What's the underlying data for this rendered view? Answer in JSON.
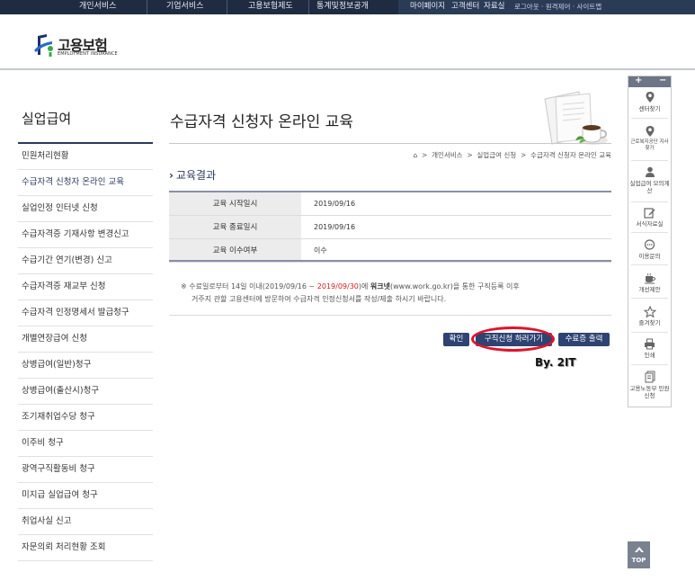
{
  "topnav": {
    "menu": [
      "개인서비스",
      "기업서비스",
      "고용보험제도",
      "통계및정보공개"
    ],
    "quick": [
      "마이페이지",
      "고객센터",
      "자료실"
    ],
    "util": "로그아웃 · 원격제어 · 사이트맵"
  },
  "logo": {
    "title": "고용보험",
    "subtitle": "EMPLOYMENT INSURANCE"
  },
  "sidebar": {
    "title": "실업급여",
    "items": [
      "민원처리현황",
      "수급자격 신청자 온라인 교육",
      "실업인정 인터넷 신청",
      "수급자격증 기재사항 변경신고",
      "수급기간 연기(변경) 신고",
      "수급자격증 재교부 신청",
      "수급자격 인정명세서 발급청구",
      "개별연장급여 신청",
      "상병급여(일반)청구",
      "상병급여(출산시)청구",
      "조기재취업수당 청구",
      "이주비 청구",
      "광역구직활동비 청구",
      "미지급 실업급여 청구",
      "취업사실 신고",
      "자문의뢰 처리현황 조회"
    ]
  },
  "main": {
    "title": "수급자격 신청자 온라인 교육",
    "breadcrumb": [
      "개인서비스",
      "실업급여 신청",
      "수급자격 신청자 온라인 교육"
    ],
    "section_title": "교육결과"
  },
  "result": {
    "rows": [
      {
        "label": "교육 시작일시",
        "value": "2019/09/16"
      },
      {
        "label": "교육 종료일시",
        "value": "2019/09/16"
      },
      {
        "label": "교육 이수여부",
        "value": "이수"
      }
    ]
  },
  "notice": {
    "l1_a": "※ 수료일로부터 14일 이내(2019/09/16 ~ ",
    "l1_red": "2019/09/30",
    "l1_b": ")에 ",
    "l1_bold": "워크넷",
    "l1_c": "(www.work.go.kr)을 통한 구직등록 이후",
    "l2": "거주지 관할 고용센터에 방문하여 수급자격 인정신청서를 작성/제출 하시기 바랍니다."
  },
  "buttons": {
    "confirm": "확인",
    "job_apply": "구직신청 하러가기",
    "certificate": "수료증 출력"
  },
  "overlay_mark": "By. 2IT",
  "quick_menu": {
    "plus": "+",
    "minus": "−",
    "items": [
      {
        "label": "센터찾기",
        "icon": "location-pin-icon"
      },
      {
        "label": "근로복지공단 지사찾기",
        "icon": "location-pin-icon"
      },
      {
        "label": "실업급여 모의계산",
        "icon": "person-icon"
      },
      {
        "label": "서식자료실",
        "icon": "edit-icon"
      },
      {
        "label": "이용문의",
        "icon": "chat-icon"
      },
      {
        "label": "개선제안",
        "icon": "cup-icon"
      },
      {
        "label": "즐겨찾기",
        "icon": "star-icon"
      },
      {
        "label": "인쇄",
        "icon": "print-icon"
      },
      {
        "label": "고용노동부 민원신청",
        "icon": "document-icon"
      }
    ]
  },
  "top_button": "TOP",
  "colors": {
    "nav_bg": "#1f2b40",
    "accent": "#2b3a5c",
    "button": "#2e4371",
    "highlight": "#e0142a",
    "date_red": "#d21a1a"
  }
}
